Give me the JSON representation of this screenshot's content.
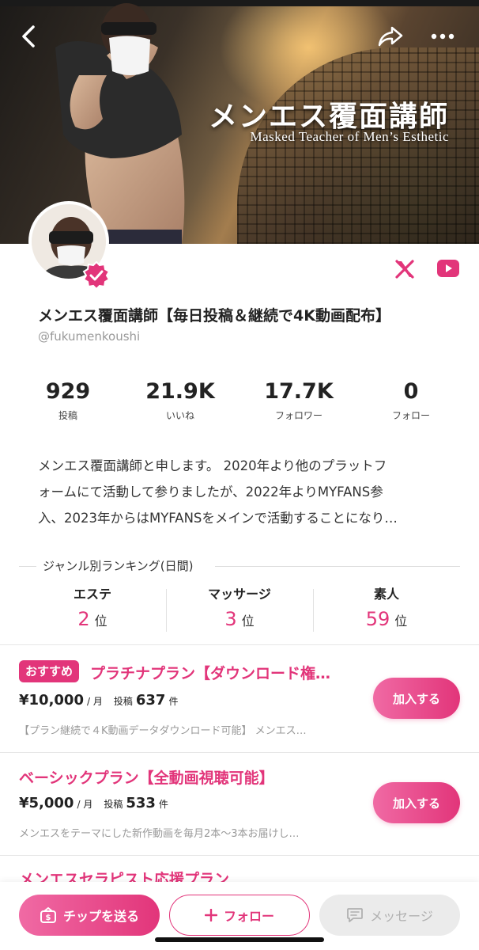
{
  "cover": {
    "title": "メンエス覆面講師",
    "subtitle": "Masked Teacher of Men’s Esthetic"
  },
  "profile": {
    "name": "メンエス覆面講師【毎日投稿＆継続で4K動画配布】",
    "handle": "@fukumenkoushi",
    "verified": true,
    "sns": [
      "x-icon",
      "youtube-icon"
    ]
  },
  "stats": [
    {
      "value": "929",
      "label": "投稿"
    },
    {
      "value": "21.9K",
      "label": "いいね"
    },
    {
      "value": "17.7K",
      "label": "フォロワー"
    },
    {
      "value": "0",
      "label": "フォロー"
    }
  ],
  "bio": {
    "line1": "メンエス覆面講師と申します。 2020年より他のプラットフ",
    "line2": "ォームにて活動して参りましたが、2022年よりMYFANS参",
    "line3": "入、2023年からはMYFANSをメインで活動することになり…"
  },
  "ranking": {
    "title": "ジャンル別ランキング(日間)",
    "items": [
      {
        "genre": "エステ",
        "rank": "2",
        "unit": "位"
      },
      {
        "genre": "マッサージ",
        "rank": "3",
        "unit": "位"
      },
      {
        "genre": "素人",
        "rank": "59",
        "unit": "位"
      }
    ]
  },
  "plans": [
    {
      "badge": "おすすめ",
      "title": "プラチナプラン【ダウンロード権…",
      "price": "¥10,000",
      "per": "/ 月",
      "posts_label": "投稿",
      "posts": "637",
      "posts_unit": "件",
      "description": "【プラン継続で４K動画データダウンロード可能】 メンエス…",
      "button": "加入する"
    },
    {
      "title": "ベーシックプラン【全動画視聴可能】",
      "price": "¥5,000",
      "per": "/ 月",
      "posts_label": "投稿",
      "posts": "533",
      "posts_unit": "件",
      "description": "メンエスをテーマにした新作動画を毎月2本〜3本お届けし…",
      "button": "加入する"
    },
    {
      "title": "メンエスセラピスト応援プラン"
    }
  ],
  "bottom_bar": {
    "tip": "チップを送る",
    "follow": "フォロー",
    "message": "メッセージ"
  },
  "colors": {
    "accent": "#e2357a",
    "accent_light": "#f06aa4",
    "muted": "#999999"
  }
}
